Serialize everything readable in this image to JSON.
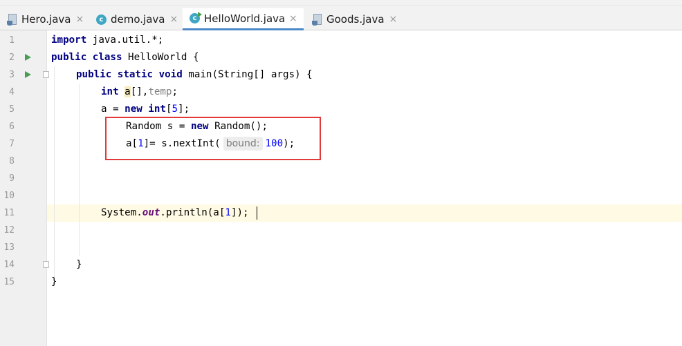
{
  "tabs": [
    {
      "label": "Hero.java",
      "icon": "java-file-icon",
      "active": false
    },
    {
      "label": "demo.java",
      "icon": "java-class-icon",
      "active": false
    },
    {
      "label": "HelloWorld.java",
      "icon": "java-class-icon",
      "active": true
    },
    {
      "label": "Goods.java",
      "icon": "java-file-icon",
      "active": false
    }
  ],
  "tab_close_glyph": "×",
  "colors": {
    "keyword": "#000080",
    "number": "#0000ff",
    "field": "#660e7a",
    "active_tab_underline": "#4a88c7",
    "current_line": "#fffae3",
    "annotation_box": "#e03a3a",
    "run_icon": "#499c54"
  },
  "editor": {
    "line_numbers": [
      "1",
      "2",
      "3",
      "4",
      "5",
      "6",
      "7",
      "8",
      "9",
      "10",
      "11",
      "12",
      "13",
      "14",
      "15"
    ],
    "current_line": 11,
    "code": {
      "l1_kw": "import",
      "l1_rest": " java.util.*;",
      "l2_kw1": "public",
      "l2_kw2": "class",
      "l2_rest": " HelloWorld {",
      "l3_kw1": "public",
      "l3_kw2": "static",
      "l3_kw3": "void",
      "l3_rest": " main(String[] args) {",
      "l4_kw": "int",
      "l4_var": "a",
      "l4_mid": "[],",
      "l4_unused": "temp",
      "l4_end": ";",
      "l5_pre": "a = ",
      "l5_kw1": "new",
      "l5_kw2": "int",
      "l5_open": "[",
      "l5_num": "5",
      "l5_close": "];",
      "l6_pre": "Random s = ",
      "l6_kw": "new",
      "l6_rest": " Random();",
      "l7_pre": "a[",
      "l7_idx": "1",
      "l7_mid": "]= s.nextInt(",
      "l7_hint": "bound:",
      "l7_num": "100",
      "l7_end": ");",
      "l11_pre": "System.",
      "l11_field": "out",
      "l11_mid": ".println(a[",
      "l11_idx": "1",
      "l11_end": "]);",
      "l14": "}",
      "l15": "}"
    }
  }
}
